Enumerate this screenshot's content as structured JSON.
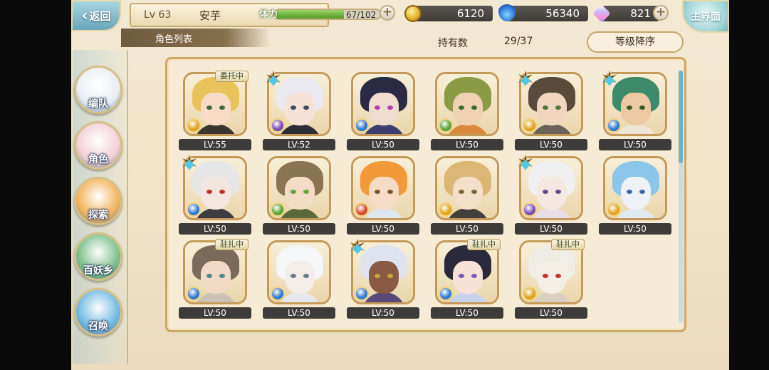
{
  "topbar": {
    "back_label": "返回",
    "level": "Lv 63",
    "player_name": "安芋",
    "section_title": "角色列表",
    "stamina_label": "体力",
    "stamina_value": "67/102",
    "stamina_fraction": 0.657,
    "coins": "6120",
    "souls": "56340",
    "gems": "821",
    "home_label": "主界面"
  },
  "side_menu": [
    {
      "label": "编队",
      "icon": "team-icon",
      "color": "#e9eef5"
    },
    {
      "label": "角色",
      "icon": "character-icon",
      "color": "#f2d0d6"
    },
    {
      "label": "探索",
      "icon": "explore-icon",
      "color": "#f2b35c"
    },
    {
      "label": "百妖乡",
      "icon": "village-icon",
      "color": "#7bbf8a"
    },
    {
      "label": "召唤",
      "icon": "summon-icon",
      "color": "#6fb9e2"
    }
  ],
  "header": {
    "count_label": "持有数",
    "count_value": "29/37",
    "sort_label": "等级降序"
  },
  "characters": [
    {
      "lv": "LV:55",
      "hair": "#e9c25a",
      "skin": "#f8dcc8",
      "outfit": "#3b3532",
      "eyes": "#3a6d3a",
      "element": "#e0a31c",
      "star": false,
      "tag": "委托中"
    },
    {
      "lv": "LV:52",
      "hair": "#e9e9ef",
      "skin": "#f6e2d7",
      "outfit": "#2d2d35",
      "eyes": "#3e4a5e",
      "element": "#7a4bb8",
      "star": true,
      "tag": ""
    },
    {
      "lv": "LV:50",
      "hair": "#2a2a44",
      "skin": "#f1dcd0",
      "outfit": "#3b3e6e",
      "eyes": "#b53fb1",
      "element": "#2d7ad4",
      "star": false,
      "tag": ""
    },
    {
      "lv": "LV:50",
      "hair": "#8b9b45",
      "skin": "#efd2b2",
      "outfit": "#d88a3a",
      "eyes": "#3a6d2a",
      "element": "#5aa33a",
      "star": false,
      "tag": ""
    },
    {
      "lv": "LV:50",
      "hair": "#5a4a3a",
      "skin": "#f1d6bf",
      "outfit": "#6b6258",
      "eyes": "#4e7a3a",
      "element": "#e0a31c",
      "star": true,
      "tag": ""
    },
    {
      "lv": "LV:50",
      "hair": "#3d8a6a",
      "skin": "#ecc9a3",
      "outfit": "#efe6d5",
      "eyes": "#3a5a2a",
      "element": "#2d7ad4",
      "star": true,
      "tag": ""
    },
    {
      "lv": "LV:50",
      "hair": "#e6e6e6",
      "skin": "#f3e6de",
      "outfit": "#3c3c40",
      "eyes": "#c53030",
      "element": "#2d7ad4",
      "star": true,
      "tag": ""
    },
    {
      "lv": "LV:50",
      "hair": "#8a7552",
      "skin": "#f4dbc3",
      "outfit": "#5a6a3a",
      "eyes": "#6aa33a",
      "element": "#5aa33a",
      "star": false,
      "tag": ""
    },
    {
      "lv": "LV:50",
      "hair": "#f29a3a",
      "skin": "#f6dcc4",
      "outfit": "#dde6ef",
      "eyes": "#7a5a2a",
      "element": "#d9472b",
      "star": false,
      "tag": ""
    },
    {
      "lv": "LV:50",
      "hair": "#dbb674",
      "skin": "#f5dfc8",
      "outfit": "#44403d",
      "eyes": "#7a6a3a",
      "element": "#e0a31c",
      "star": false,
      "tag": ""
    },
    {
      "lv": "LV:50",
      "hair": "#f0f0f0",
      "skin": "#f5e8e2",
      "outfit": "#e8dfe6",
      "eyes": "#6a4a8a",
      "element": "#7a4bb8",
      "star": true,
      "tag": ""
    },
    {
      "lv": "LV:50",
      "hair": "#8cc6ea",
      "skin": "#eef1f5",
      "outfit": "#dfe9f0",
      "eyes": "#3a6aa3",
      "element": "#e0a31c",
      "star": false,
      "tag": ""
    },
    {
      "lv": "LV:50",
      "hair": "#7a6a5a",
      "skin": "#f2dac6",
      "outfit": "#c9c2b5",
      "eyes": "#4a8a8a",
      "element": "#2d7ad4",
      "star": false,
      "tag": "驻扎中"
    },
    {
      "lv": "LV:50",
      "hair": "#f4f6f8",
      "skin": "#f4ece8",
      "outfit": "#e4e7ec",
      "eyes": "#6a7a8a",
      "element": "#2d7ad4",
      "star": false,
      "tag": ""
    },
    {
      "lv": "LV:50",
      "hair": "#dfe3f0",
      "skin": "#8a5a44",
      "outfit": "#5a4a7a",
      "eyes": "#c8a83a",
      "element": "#2d7ad4",
      "star": true,
      "tag": ""
    },
    {
      "lv": "LV:50",
      "hair": "#2a2a3a",
      "skin": "#f6e2d6",
      "outfit": "#c8d2ea",
      "eyes": "#7a5ab8",
      "element": "#2d7ad4",
      "star": false,
      "tag": "驻扎中"
    },
    {
      "lv": "LV:50",
      "hair": "#f0ede6",
      "skin": "#f3efe6",
      "outfit": "#d9cfc0",
      "eyes": "#c53030",
      "element": "#e0a31c",
      "star": false,
      "tag": "驻扎中"
    }
  ]
}
